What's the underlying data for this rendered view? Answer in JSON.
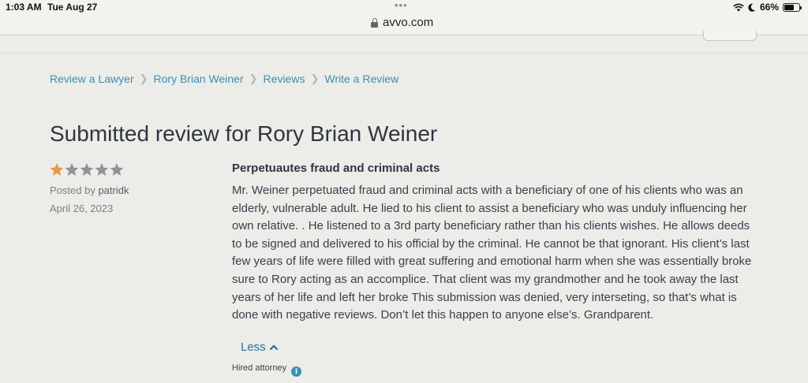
{
  "status_bar": {
    "time": "1:03 AM",
    "date": "Tue Aug 27",
    "battery": "66%",
    "icons": [
      "wifi-icon",
      "moon-icon",
      "battery-icon"
    ]
  },
  "browser": {
    "url": "avvo.com"
  },
  "breadcrumb": [
    {
      "label": "Review a Lawyer"
    },
    {
      "label": "Rory Brian Weiner"
    },
    {
      "label": "Reviews"
    },
    {
      "label": "Write a Review"
    }
  ],
  "page": {
    "title": "Submitted review for Rory Brian Weiner"
  },
  "review": {
    "rating": 1,
    "max_rating": 5,
    "posted_by_prefix": "Posted by",
    "author": "patridk",
    "date": "April 26, 2023",
    "title": "Perpetuautes fraud and criminal acts",
    "body": "Mr. Weiner perpetuated fraud and criminal acts with a beneficiary of one of his clients who was an elderly, vulnerable adult. He lied to his client to assist a beneficiary who was unduly influencing her own relative. . He listened to a 3rd party beneficiary rather than his clients wishes. He allows deeds to be signed and delivered to his official by the criminal. He cannot be that ignorant. His client’s last few years of life were filled with great suffering and emotional harm when she was essentially broke sure to Rory acting as an accomplice. That client was my grandmother and he took away the last years of her life and left her broke This submission was denied, very interseting, so that’s what is done with negative reviews. Don’t let this happen to anyone else’s. Grandparent.",
    "toggle_label": "Less",
    "hired_label": "Hired attorney"
  },
  "colors": {
    "star_filled": "#e8984a",
    "star_empty": "#8e939c",
    "link": "#3a8fb5"
  }
}
